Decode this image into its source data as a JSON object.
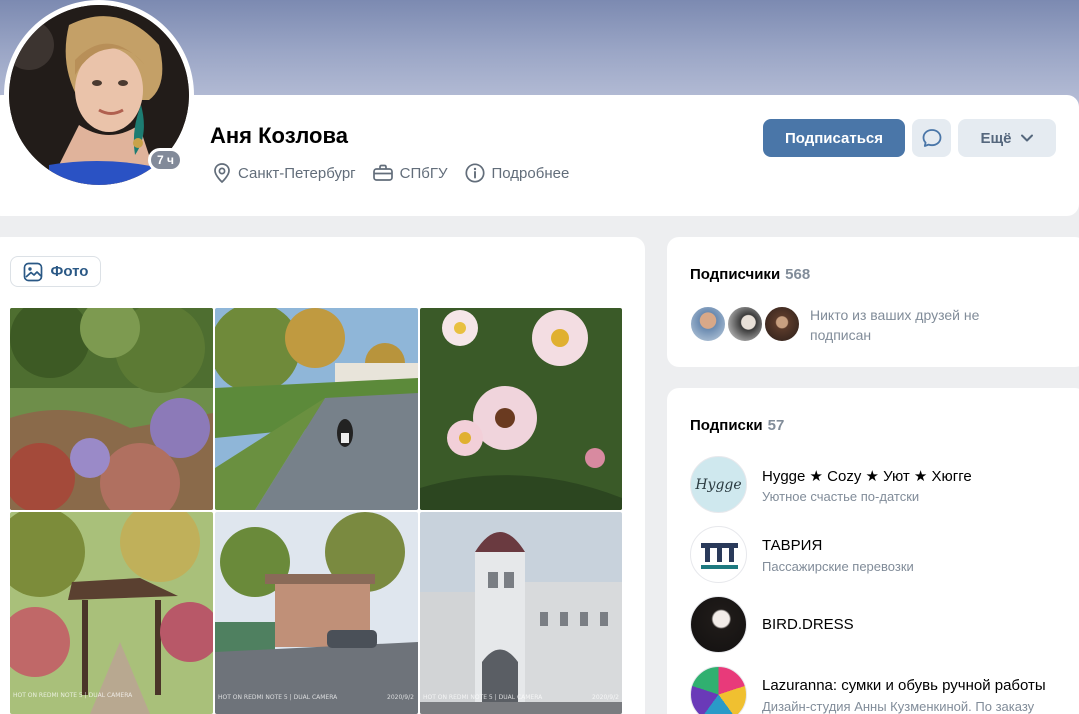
{
  "profile": {
    "name": "Аня Козлова",
    "online_badge": "7 ч",
    "city": "Санкт-Петербург",
    "university": "СПбГУ",
    "details_link": "Подробнее",
    "subscribe_label": "Подписаться",
    "more_label": "Ещё"
  },
  "photos": {
    "tab_label": "Фото",
    "stamps": [
      "HOT ON REDMI NOTE 5 | DUAL CAMERA",
      "2020/9/2"
    ]
  },
  "followers": {
    "title": "Подписчики",
    "count": "568",
    "note": "Никто из ваших друзей не подписан"
  },
  "subscriptions": {
    "title": "Подписки",
    "count": "57",
    "items": [
      {
        "name": "Hygge ★ Cozy ★ Уют ★ Хюгге",
        "desc": "Уютное счастье по-датски",
        "logo_text": "Hygge"
      },
      {
        "name": "ТАВРИЯ",
        "desc": "Пассажирские перевозки",
        "logo_text": ""
      },
      {
        "name": "BIRD.DRESS",
        "desc": "",
        "logo_text": ""
      },
      {
        "name": "Lazuranna: сумки и обувь ручной работы",
        "desc": "Дизайн-студия Анны Кузменкиной. По заказу",
        "logo_text": ""
      }
    ]
  },
  "colors": {
    "accent": "#4a76a8",
    "secondary_button": "#e5ebf1",
    "muted_text": "#818c99",
    "background": "#edeef0"
  }
}
